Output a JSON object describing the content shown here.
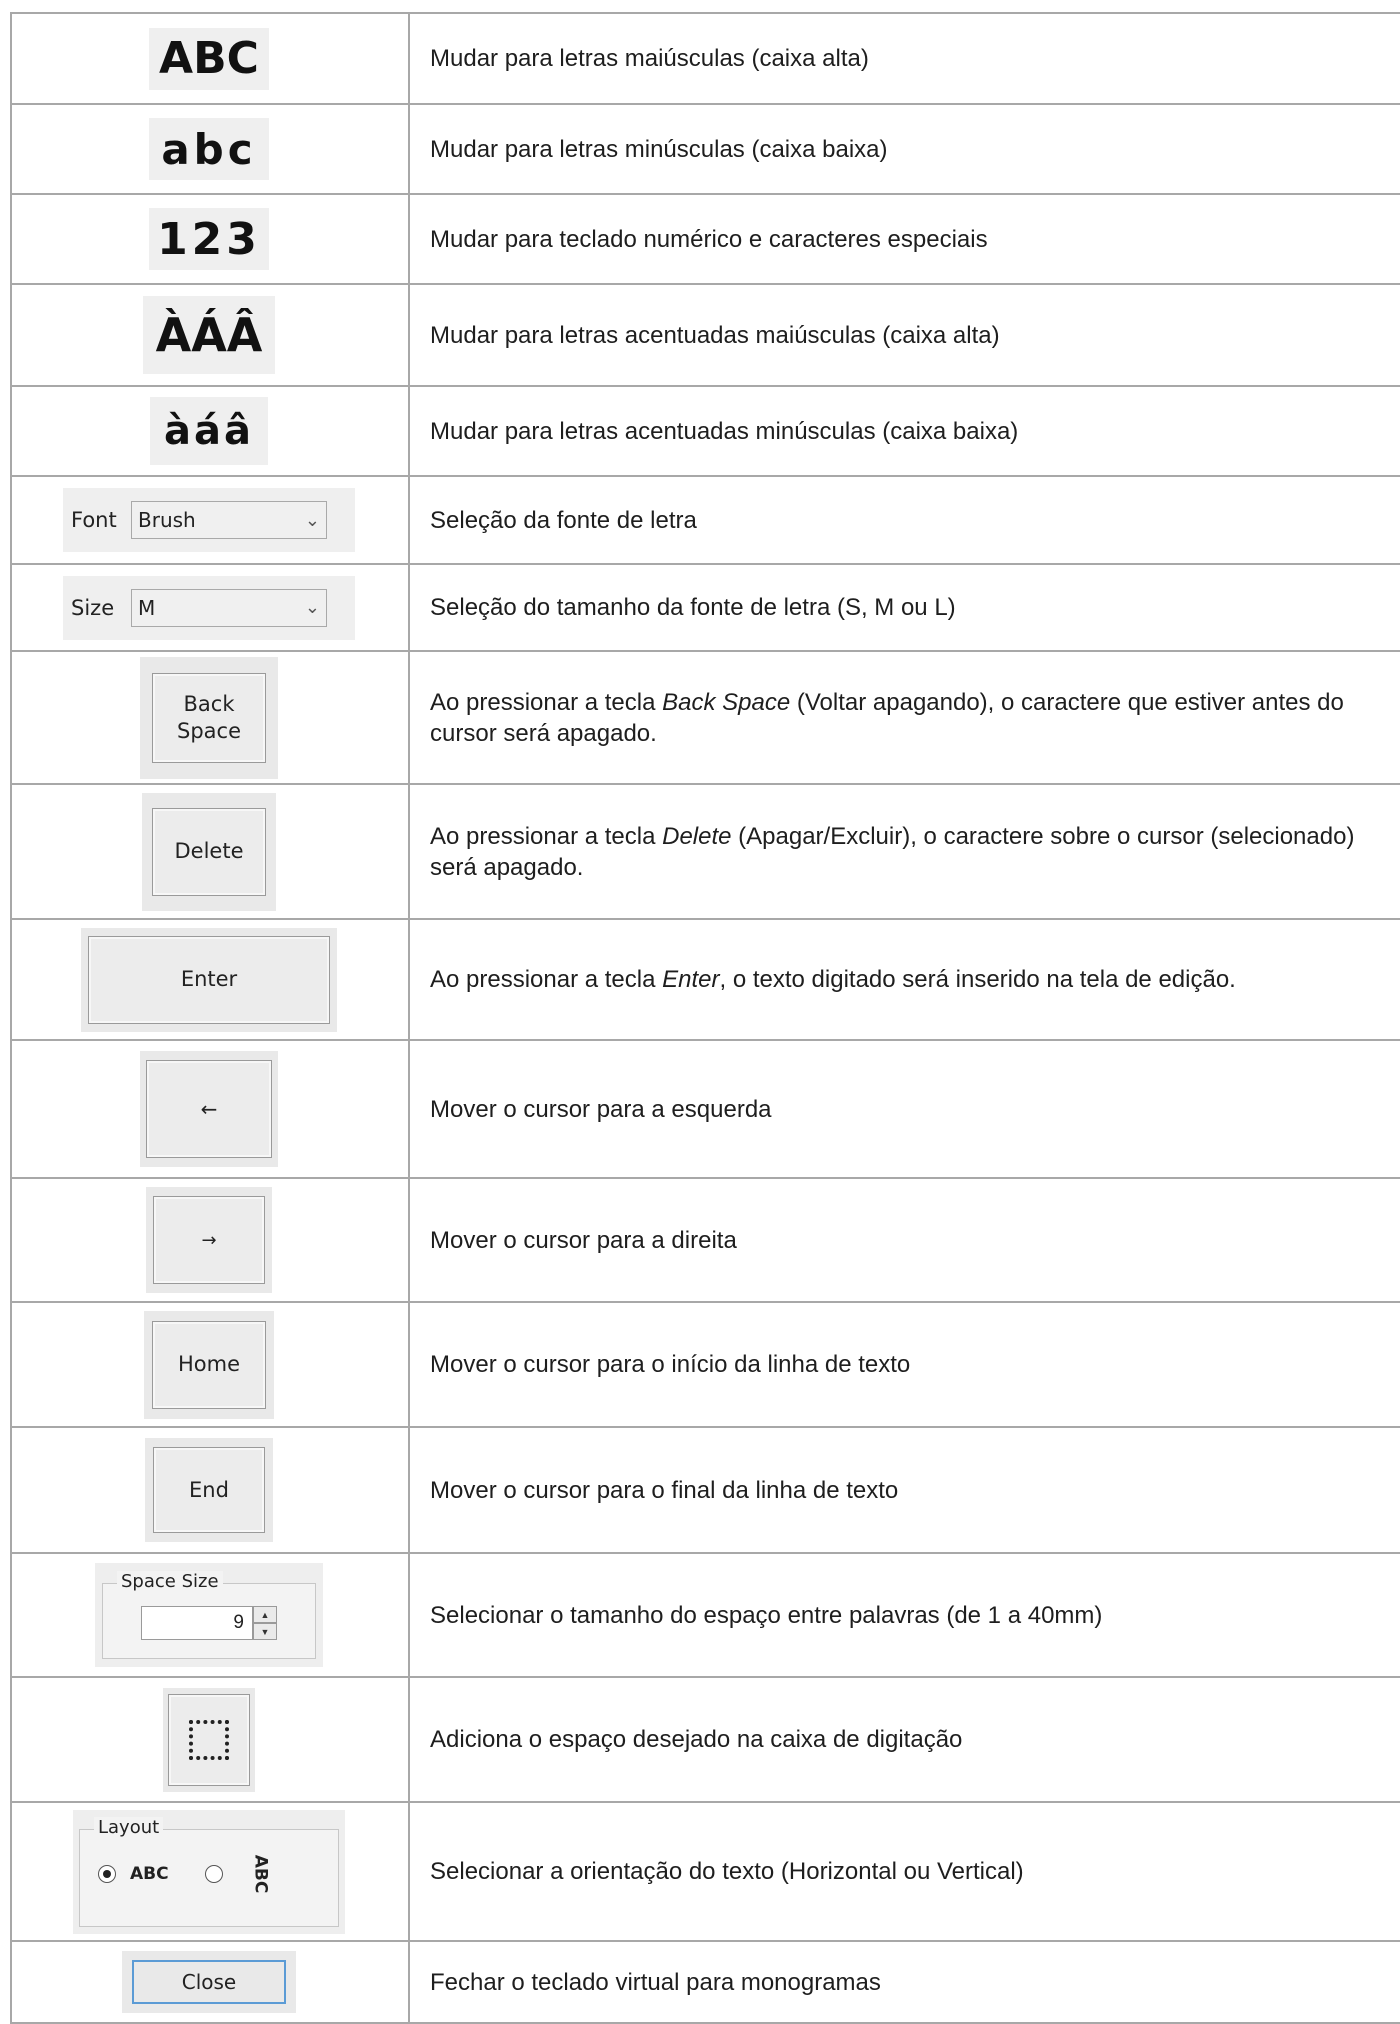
{
  "rows": [
    {
      "icon": {
        "kind": "letters",
        "text": "ABC"
      },
      "desc": "Mudar para letras maiúsculas (caixa alta)"
    },
    {
      "icon": {
        "kind": "letters",
        "text": "abc"
      },
      "desc": "Mudar para letras minúsculas (caixa baixa)"
    },
    {
      "icon": {
        "kind": "letters",
        "text": "123"
      },
      "desc": "Mudar para teclado numérico e caracteres especiais"
    },
    {
      "icon": {
        "kind": "letters",
        "text": "ÀÁÂ"
      },
      "desc": "Mudar para letras acentuadas maiúsculas (caixa alta)"
    },
    {
      "icon": {
        "kind": "letters",
        "text": "àáâ"
      },
      "desc": "Mudar para letras acentuadas minúsculas (caixa baixa)"
    },
    {
      "icon": {
        "kind": "combo",
        "label": "Font",
        "value": "Brush"
      },
      "desc": "Seleção da fonte de letra"
    },
    {
      "icon": {
        "kind": "combo",
        "label": "Size",
        "value": "M"
      },
      "desc": "Seleção do tamanho da fonte de letra (S, M ou L)"
    },
    {
      "icon": {
        "kind": "button",
        "line1": "Back",
        "line2": "Space"
      },
      "desc_pre": "Ao pressionar a tecla ",
      "desc_em": "Back Space",
      "desc_post": " (Voltar apagando), o caractere que estiver antes do cursor será apagado."
    },
    {
      "icon": {
        "kind": "button",
        "line1": "Delete"
      },
      "desc_pre": "Ao pressionar a tecla ",
      "desc_em": "Delete",
      "desc_post": " (Apagar/Excluir), o caractere sobre o cursor (selecionado) será apagado."
    },
    {
      "icon": {
        "kind": "button",
        "line1": "Enter"
      },
      "desc_pre": "Ao pressionar a tecla ",
      "desc_em": "Enter",
      "desc_post": ", o texto digitado será inserido na tela de edição."
    },
    {
      "icon": {
        "kind": "button",
        "line1": "←"
      },
      "desc": "Mover o cursor para a esquerda"
    },
    {
      "icon": {
        "kind": "button",
        "line1": "→"
      },
      "desc": "Mover o cursor para a direita"
    },
    {
      "icon": {
        "kind": "button",
        "line1": "Home"
      },
      "desc": "Mover o cursor para o início da linha de texto"
    },
    {
      "icon": {
        "kind": "button",
        "line1": "End"
      },
      "desc": "Mover o cursor para o final da linha de texto"
    },
    {
      "icon": {
        "kind": "spin",
        "label": "Space Size",
        "value": "9"
      },
      "desc": "Selecionar o tamanho do espaço entre palavras (de 1 a 40mm)"
    },
    {
      "icon": {
        "kind": "space",
        "name": "dotted-square-icon"
      },
      "desc": "Adiciona o espaço desejado na caixa de digitação"
    },
    {
      "icon": {
        "kind": "layout",
        "label": "Layout",
        "opt1": "ABC",
        "opt2": "ABC"
      },
      "desc": "Selecionar a orientação do texto (Horizontal ou Vertical)"
    },
    {
      "icon": {
        "kind": "button",
        "line1": "Close"
      },
      "desc": "Fechar o teclado virtual para monogramas"
    }
  ]
}
